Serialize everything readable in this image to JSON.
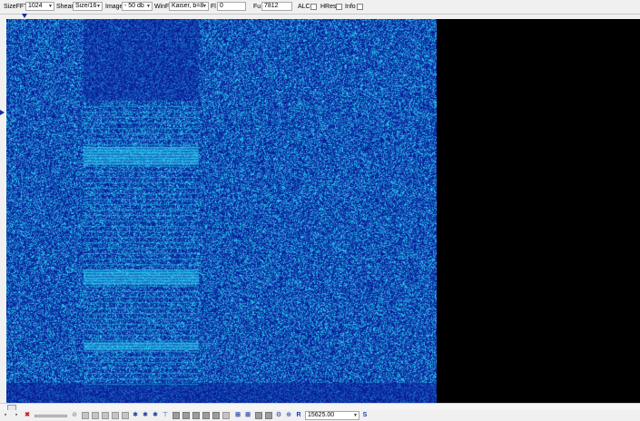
{
  "toolbar": {
    "size_fft_label": "SizeFFT",
    "size_fft_value": "1024",
    "shear_label": "Shear",
    "shear_value": "Size/16",
    "image_label": "Image",
    "image_value": "- 50 db",
    "winf_label": "WinF",
    "winf_value": "Kaiser, b=8",
    "fl_label": "Fl",
    "fl_value": "0",
    "fu_label": "Fu",
    "fu_value": "7812",
    "alc_label": "ALC",
    "alc_checked": false,
    "hres_label": "HRes",
    "hres_checked": false,
    "info_label": "Info",
    "info_checked": false
  },
  "spectrogram": {
    "background_color": "#0a1aa8",
    "signal_color": "#29d6ff",
    "empty_region_color": "#000000"
  },
  "bottombar": {
    "rate_value": "15625.00",
    "icons": [
      "close-icon",
      "stop-icon",
      "rewind-icon",
      "doc-icon",
      "doc-icon",
      "doc-icon",
      "doc-icon",
      "doc-icon",
      "doc-icon",
      "zoom-in-icon",
      "zoom-out-icon",
      "star-icon",
      "t-scale-icon",
      "doc-icon",
      "doc-icon",
      "doc-icon",
      "doc-icon",
      "doc-icon",
      "doc-icon",
      "doc-icon",
      "doc-icon",
      "l1-icon",
      "l2-icon",
      "doc-icon",
      "doc-icon",
      "settings-icon",
      "zoom-icon",
      "r-icon",
      "dropdown-icon",
      "s-icon"
    ],
    "r_label": "R",
    "s_label": "S"
  }
}
